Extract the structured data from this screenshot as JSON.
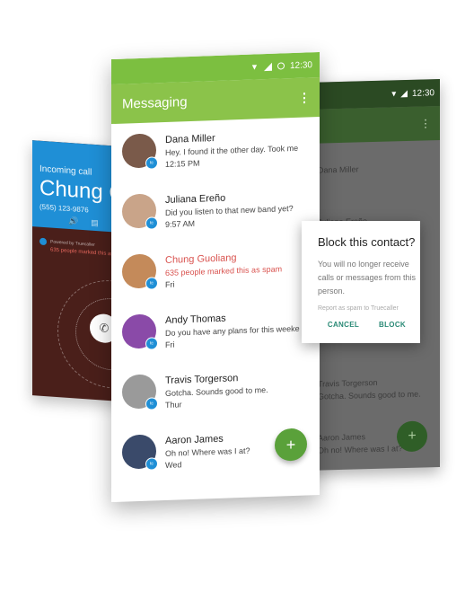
{
  "incoming_call": {
    "status": "Incoming call",
    "caller_name": "Chung Guoliang",
    "caller_number": "(555) 123-9876",
    "powered_by": "Powered by Truecaller",
    "spam_warning": "635 people marked this as spam"
  },
  "dialog_phone": {
    "status_time": "12:30",
    "dialog": {
      "title": "Block this contact?",
      "body": "You will no longer receive calls or messages from this person.",
      "checkbox_label": "Report as spam to Truecaller",
      "cancel_label": "CANCEL",
      "block_label": "BLOCK"
    },
    "background_rows": [
      "Dana Miller",
      "Juliana Ereño",
      "Travis Torgerson",
      "Aaron James"
    ],
    "background_previews": [
      "Gotcha. Sounds good to me.",
      "Oh no! Where was I at?"
    ]
  },
  "messaging": {
    "status_time": "12:30",
    "title": "Messaging",
    "accent_color": "#8bc34a",
    "spam_color": "#d9534f",
    "conversations": [
      {
        "name": "Dana Miller",
        "message": "Hey. I found it the other day. Took me",
        "time": "12:15 PM",
        "spam": false,
        "avatar_color": "#7a5a4a"
      },
      {
        "name": "Juliana Ereño",
        "message": "Did you listen to that new band yet?",
        "time": "9:57 AM",
        "spam": false,
        "avatar_color": "#c9a489"
      },
      {
        "name": "Chung Guoliang",
        "message": "635 people marked this as spam",
        "time": "Fri",
        "spam": true,
        "avatar_color": "#c48a5a"
      },
      {
        "name": "Andy Thomas",
        "message": "Do you have any plans for this weeke",
        "time": "Fri",
        "spam": false,
        "avatar_color": "#8a4aa8"
      },
      {
        "name": "Travis Torgerson",
        "message": "Gotcha. Sounds good to me.",
        "time": "Thur",
        "spam": false,
        "avatar_color": "#9a9a9a"
      },
      {
        "name": "Aaron James",
        "message": "Oh no! Where was I at?",
        "time": "Wed",
        "spam": false,
        "avatar_color": "#3a4a6a"
      }
    ],
    "fab_icon": "+",
    "badge_text": "tc"
  }
}
